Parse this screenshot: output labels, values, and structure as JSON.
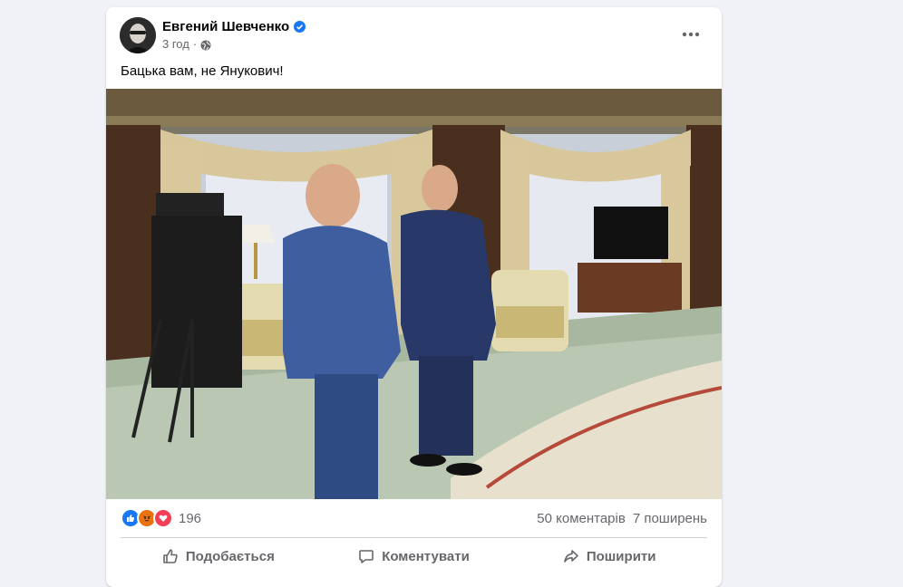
{
  "post": {
    "author": "Евгений Шевченко",
    "time": "3 год",
    "separator": "·",
    "text": "Бацька вам, не Янукович!",
    "verified_icon": "verified-badge-icon",
    "privacy_icon": "globe-icon"
  },
  "photo": {
    "icon": "photo-image"
  },
  "reactions": {
    "icons": [
      "like-icon",
      "angry-icon",
      "love-icon"
    ],
    "count": "196",
    "comments": "50 коментарів",
    "shares": "7 поширень"
  },
  "actions": {
    "like": "Подобається",
    "comment": "Коментувати",
    "share": "Поширити"
  },
  "colors": {
    "accent": "#1877f2",
    "text_secondary": "#65676b",
    "background": "#f0f2f5",
    "angry": "#e9710f",
    "love": "#f33e58"
  }
}
